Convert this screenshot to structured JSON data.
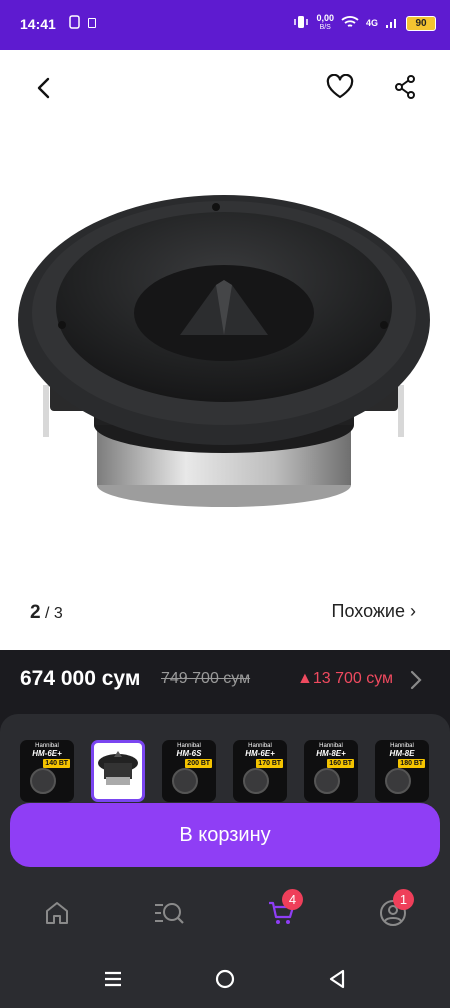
{
  "status_bar": {
    "time": "14:41",
    "net_speed_value": "0,00",
    "net_speed_unit": "B/S",
    "network": "4G",
    "battery": "90"
  },
  "product": {
    "gallery_current": "2",
    "gallery_total": "/ 3",
    "similar_label": "Похожие ›",
    "image_icon": "tweeter-speaker-image"
  },
  "price": {
    "current": "674 000 сум",
    "old": "749 700 сум",
    "delta": "▲13 700 сум",
    "delta_color": "#ef4a5f"
  },
  "variants": [
    {
      "title": "Hannibal",
      "model": "HM-6E+",
      "badge": "140 ВТ",
      "selected": false
    },
    {
      "title": "",
      "model": "",
      "badge": "",
      "selected": true
    },
    {
      "title": "Hannibal",
      "model": "HM-6S",
      "badge": "200 ВТ",
      "selected": false
    },
    {
      "title": "Hannibal",
      "model": "HM-6E+",
      "badge": "170 ВТ",
      "selected": false
    },
    {
      "title": "Hannibal",
      "model": "HM-8E+",
      "badge": "160 ВТ",
      "selected": false
    },
    {
      "title": "Hannibal",
      "model": "HM-8E",
      "badge": "180 ВТ",
      "selected": false
    }
  ],
  "cart_button": {
    "label": "В корзину",
    "color": "#8f3ef5"
  },
  "bottom_nav": {
    "items": [
      {
        "name": "home",
        "icon": "home-icon"
      },
      {
        "name": "catalog",
        "icon": "search-catalog-icon"
      },
      {
        "name": "cart",
        "icon": "cart-icon",
        "badge": "4"
      },
      {
        "name": "profile",
        "icon": "profile-icon",
        "badge": "1"
      }
    ]
  },
  "colors": {
    "brand": "#5e1bd0",
    "accent": "#8f3ef5",
    "badge": "#ef3f5a"
  }
}
